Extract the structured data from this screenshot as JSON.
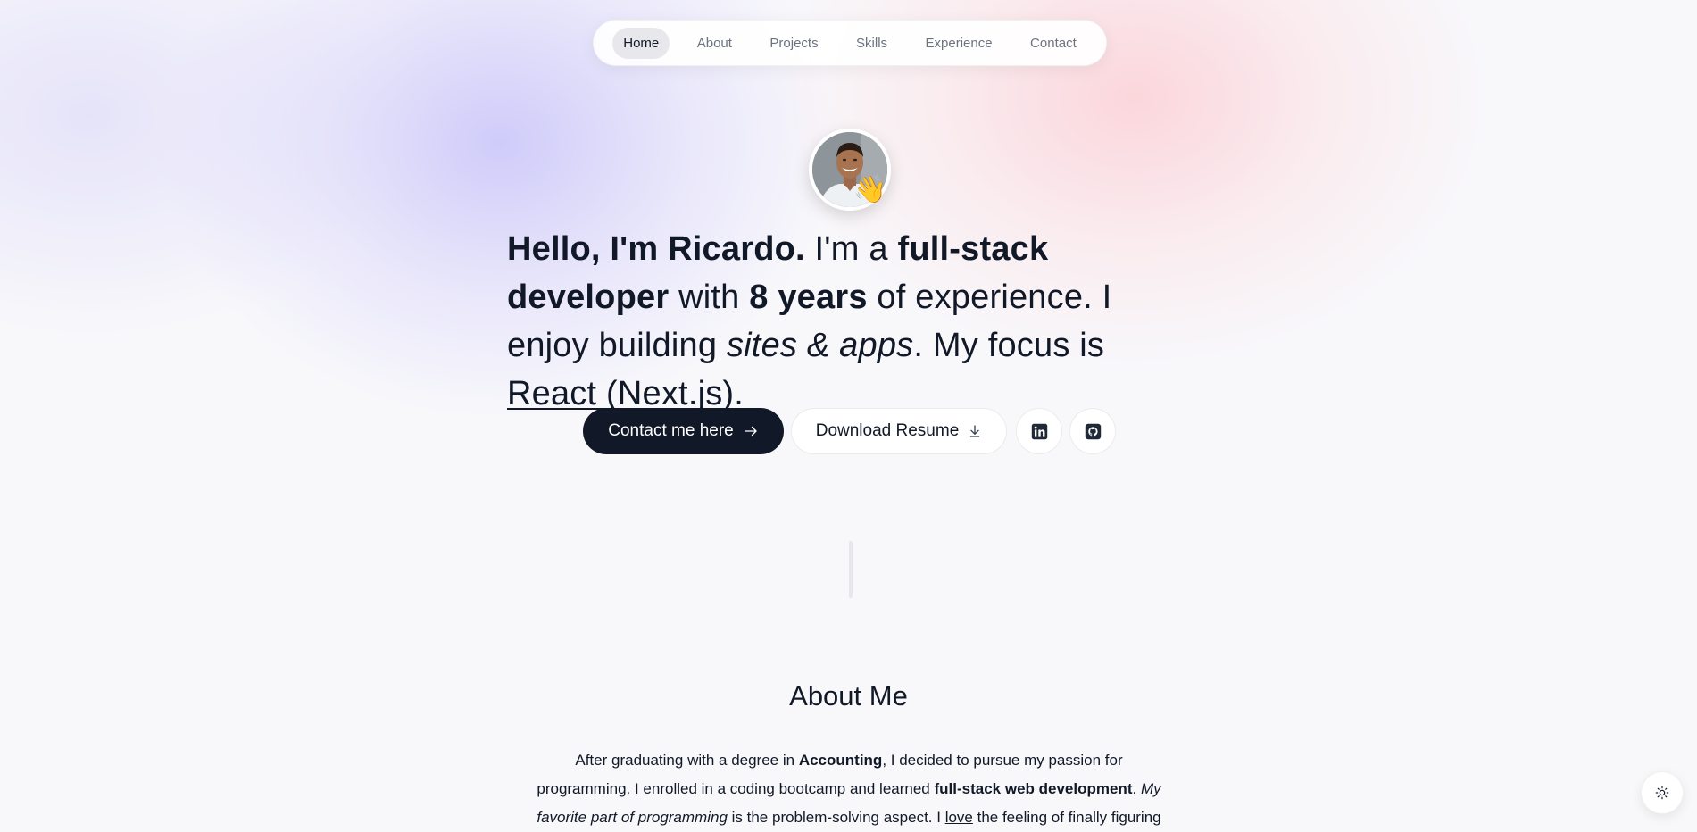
{
  "nav": {
    "items": [
      {
        "label": "Home",
        "active": true
      },
      {
        "label": "About"
      },
      {
        "label": "Projects"
      },
      {
        "label": "Skills"
      },
      {
        "label": "Experience"
      },
      {
        "label": "Contact"
      }
    ]
  },
  "hero": {
    "avatar_icon": "profile-photo",
    "wave_emoji": "👋",
    "greeting": "Hello, I'm Ricardo.",
    "t1": " I'm a ",
    "role": "full-stack developer",
    "t2": " with ",
    "years": "8 years",
    "t3": " of experience. I enjoy building ",
    "build": "sites & apps",
    "t4": ". My focus is ",
    "focus": "React (Next.js)",
    "t5": "."
  },
  "actions": {
    "contact_label": "Contact me here",
    "contact_icon": "arrow-right-icon",
    "resume_label": "Download Resume",
    "resume_icon": "download-icon",
    "linkedin_icon": "linkedin-icon",
    "github_icon": "github-icon"
  },
  "about": {
    "title": "About Me",
    "p1": "After graduating with a degree in ",
    "degree": "Accounting",
    "p2": ", I decided to pursue my passion for programming. I enrolled in a coding bootcamp and learned ",
    "skill": "full-stack web development",
    "p3": ". ",
    "fav": "My favorite part of programming",
    "p4": " is the problem-solving aspect. I ",
    "love": "love",
    "p5": " the feeling of finally figuring"
  },
  "theme_toggle": {
    "icon": "sun-icon"
  },
  "colors": {
    "primary_dark": "#111827",
    "nav_active_bg": "#e8e8ec",
    "text_muted": "#6b7280"
  }
}
